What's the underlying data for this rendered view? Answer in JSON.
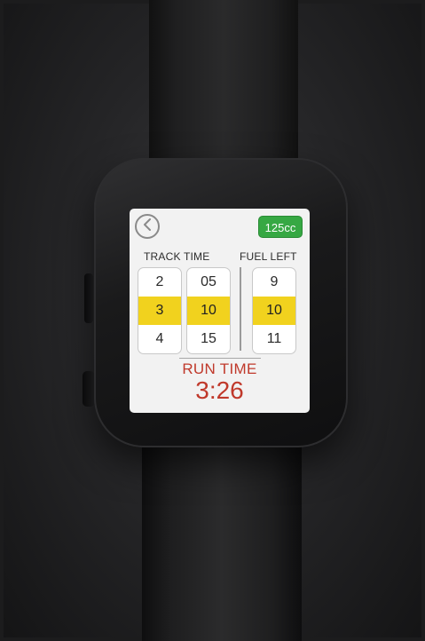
{
  "header": {
    "back_icon": "chevron-left-icon",
    "engine_badge": "125cc",
    "badge_color": "#36a843"
  },
  "track_time": {
    "title": "TRACK TIME",
    "hours": [
      "2",
      "3",
      "4"
    ],
    "minutes": [
      "05",
      "10",
      "15"
    ],
    "selected_hours": "3",
    "selected_minutes": "10"
  },
  "fuel_left": {
    "title": "FUEL LEFT",
    "values": [
      "9",
      "10",
      "11"
    ],
    "selected": "10"
  },
  "run_time": {
    "label": "RUN TIME",
    "value": "3:26",
    "color": "#c0392b"
  },
  "highlight_color": "#f1d21e"
}
